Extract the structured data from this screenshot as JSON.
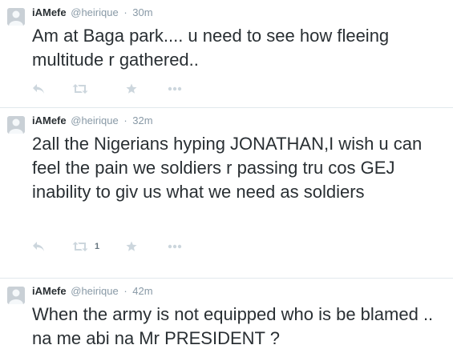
{
  "colors": {
    "text": "#292f33",
    "muted": "#8899a6",
    "icon": "#ccd6dd",
    "divider": "#e1e8ed"
  },
  "tweets": [
    {
      "fullname": "iAMefe",
      "username": "@heirique",
      "separator": "·",
      "time": "30m",
      "text": "Am at Baga park.... u need to see how fleeing multitude r gathered..",
      "retweet_count": "",
      "icons": [
        "reply-icon",
        "retweet-icon",
        "favorite-icon",
        "more-icon"
      ]
    },
    {
      "fullname": "iAMefe",
      "username": "@heirique",
      "separator": "·",
      "time": "32m",
      "text": "2all the Nigerians hyping JONATHAN,I wish u can feel the pain we soldiers r passing tru cos GEJ inability to giv us what we need as soldiers",
      "retweet_count": "1",
      "icons": [
        "reply-icon",
        "retweet-icon",
        "favorite-icon",
        "more-icon"
      ]
    },
    {
      "fullname": "iAMefe",
      "username": "@heirique",
      "separator": "·",
      "time": "42m",
      "text": "When the army is not equipped who is be blamed .. na me abi na Mr PRESIDENT ?",
      "retweet_count": "",
      "icons": []
    }
  ]
}
